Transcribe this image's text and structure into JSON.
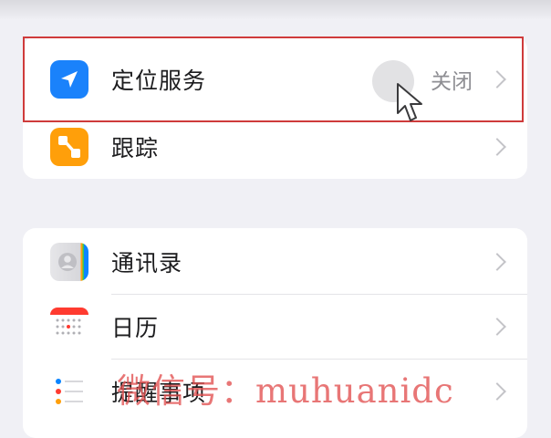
{
  "privacy_settings": {
    "group_1": [
      {
        "label": "定位服务",
        "value": "关闭",
        "icon": "location-arrow-icon"
      },
      {
        "label": "跟踪",
        "value": "",
        "icon": "tracking-icon"
      }
    ],
    "group_2": [
      {
        "label": "通讯录",
        "icon": "contacts-icon"
      },
      {
        "label": "日历",
        "icon": "calendar-icon"
      },
      {
        "label": "提醒事项",
        "icon": "reminders-icon"
      }
    ]
  },
  "watermark": "微信号：muhuanidc",
  "colors": {
    "background": "#f0f0f5",
    "location_icon": "#1a82fb",
    "tracking_icon": "#ff9f0a",
    "highlight_border": "#cf3b3b",
    "watermark": "#e25050"
  }
}
